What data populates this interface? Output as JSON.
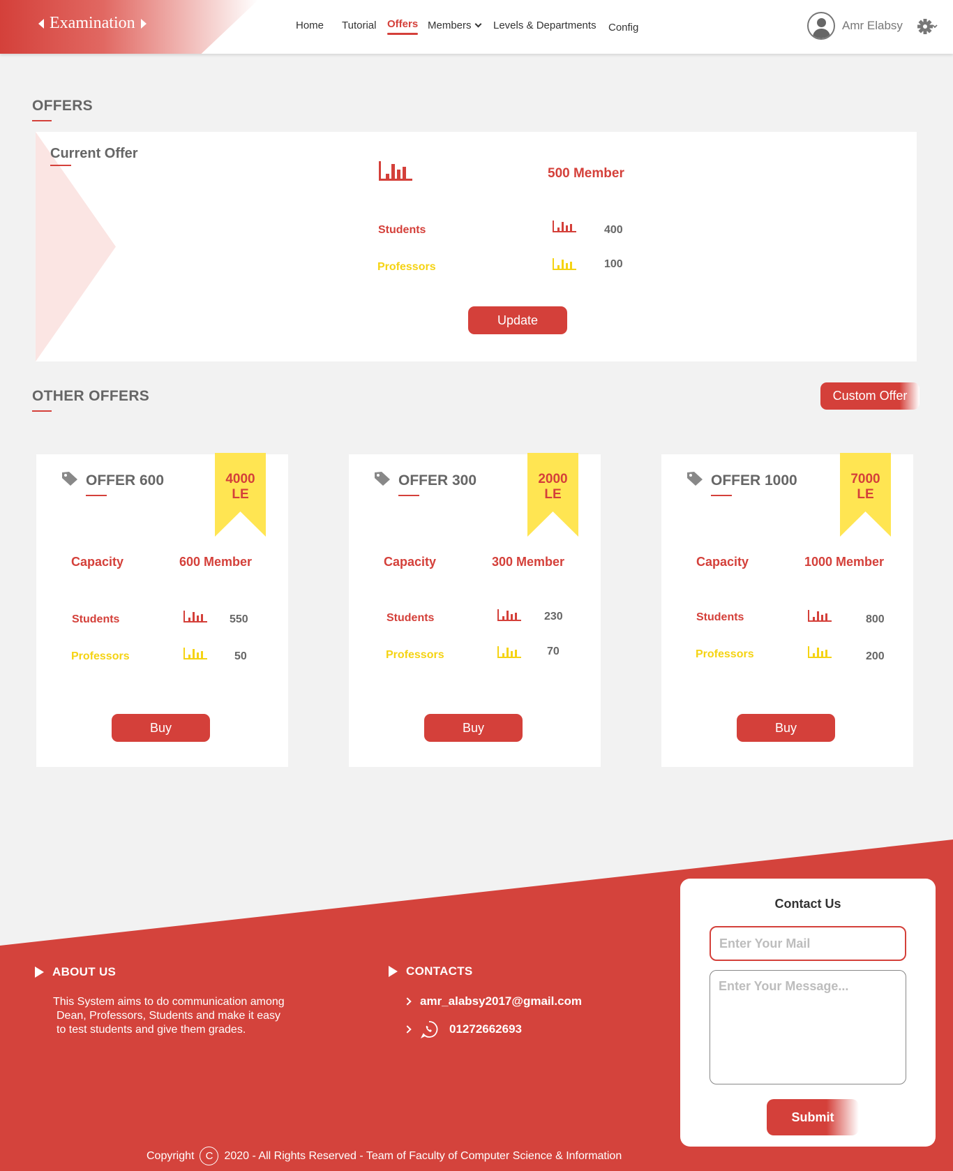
{
  "header": {
    "logo_text": "Examination",
    "nav": [
      {
        "label": "Home"
      },
      {
        "label": "Tutorial"
      },
      {
        "label": "Offers"
      },
      {
        "label": "Members"
      },
      {
        "label": "Levels & Departments"
      },
      {
        "label": "Config"
      }
    ],
    "active_nav": "Offers",
    "user_name": "Amr Elabsy"
  },
  "offers_title": "OFFERS",
  "current_offer": {
    "title": "Current Offer",
    "capacity": "500 Member",
    "students_label": "Students",
    "students_value": "400",
    "professors_label": "Professors",
    "professors_value": "100",
    "update_label": "Update"
  },
  "other_offers_title": "OTHER OFFERS",
  "custom_offer_label": "Custom Offer",
  "offers": [
    {
      "name": "OFFER 600",
      "price_line1": "4000",
      "price_line2": "LE",
      "capacity_label": "Capacity",
      "capacity": "600 Member",
      "students_label": "Students",
      "students": "550",
      "professors_label": "Professors",
      "professors": "50",
      "buy_label": "Buy"
    },
    {
      "name": "OFFER 300",
      "price_line1": "2000",
      "price_line2": "LE",
      "capacity_label": "Capacity",
      "capacity": "300 Member",
      "students_label": "Students",
      "students": "230",
      "professors_label": "Professors",
      "professors": "70",
      "buy_label": "Buy"
    },
    {
      "name": "OFFER 1000",
      "price_line1": "7000",
      "price_line2": "LE",
      "capacity_label": "Capacity",
      "capacity": "1000 Member",
      "students_label": "Students",
      "students": "800",
      "professors_label": "Professors",
      "professors": "200",
      "buy_label": "Buy"
    }
  ],
  "footer": {
    "about_title": "ABOUT US",
    "about_lines": [
      "This System aims to do communication among",
      "Dean, Professors, Students and make it easy",
      "to test students and give them grades."
    ],
    "contacts_title": "CONTACTS",
    "email": "amr_alabsy2017@gmail.com",
    "phone": "01272662693",
    "copyright_label": "Copyright",
    "copyright_symbol": "C",
    "copyright_text": "2020 - All Rights Reserved - Team of Faculty of Computer Science & Information"
  },
  "contact_form": {
    "title": "Contact Us",
    "mail_placeholder": "Enter Your Mail",
    "message_placeholder": "Enter Your Message...",
    "submit_label": "Submit"
  },
  "colors": {
    "accent": "#d4403a",
    "yellow": "#f5d313",
    "ribbon": "#ffe552",
    "background": "#f2f2f2"
  },
  "icons": [
    "chevron-left-icon",
    "chevron-right-icon",
    "chevron-down-icon",
    "user-avatar-icon",
    "gear-icon",
    "bar-chart-icon",
    "tag-icon",
    "play-triangle-icon",
    "whatsapp-icon",
    "copyright-icon"
  ]
}
